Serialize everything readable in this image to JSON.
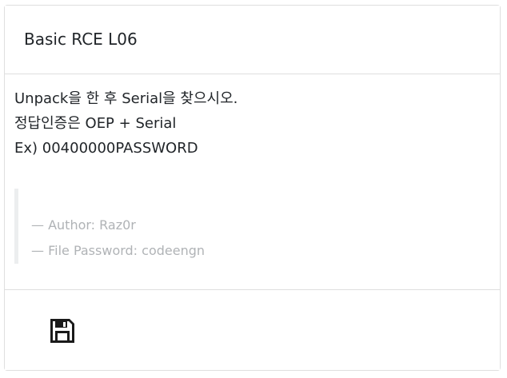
{
  "card": {
    "title": "Basic RCE L06",
    "description": [
      "Unpack을 한 후 Serial을 찾으시오.",
      "정답인증은 OEP + Serial",
      "Ex) 00400000PASSWORD"
    ],
    "author_line": "— Author: Raz0r",
    "password_line": "— File Password: codeengn"
  },
  "footer": {
    "download_icon": "floppy-disk-icon"
  },
  "colors": {
    "border": "#dfdfdf",
    "text": "#212529",
    "muted": "#b0b3b6",
    "quote_bar": "#eceeef"
  }
}
